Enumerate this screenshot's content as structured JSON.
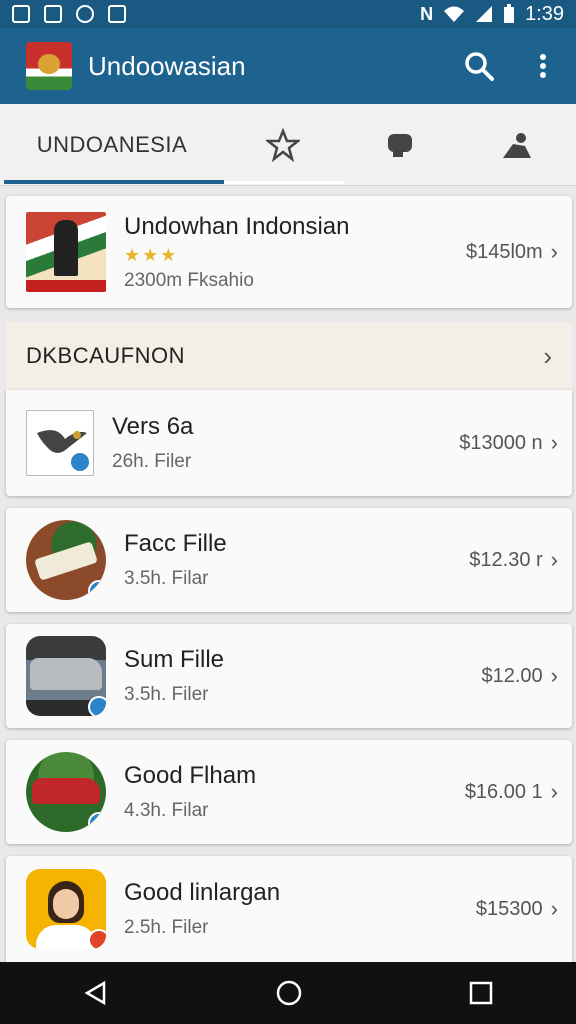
{
  "status_bar": {
    "network_label": "N",
    "time": "1:39",
    "icons": [
      "notification-icon",
      "notification-icon",
      "notification-icon",
      "notification-icon",
      "wifi-icon",
      "signal-icon",
      "battery-icon"
    ]
  },
  "app_bar": {
    "title": "Undoowasian",
    "logo": "flag-logo",
    "actions": [
      "search-icon",
      "more-vert-icon"
    ]
  },
  "tabs": [
    {
      "label": "UNDOANESIA",
      "selected": true
    },
    {
      "icon": "star-icon"
    },
    {
      "icon": "chat-icon"
    },
    {
      "icon": "person-icon"
    }
  ],
  "featured": {
    "title": "Undowhan Indonsian",
    "rating_stars": 3,
    "subtitle": "2300m Fksahio",
    "price": "$145l0m"
  },
  "section": {
    "title": "DKBCAUFNON"
  },
  "items": [
    {
      "name": "Vers 6a",
      "sub": "26h. Filer",
      "price": "$13000 n"
    },
    {
      "name": "Facc Fille",
      "sub": "3.5h. Filar",
      "price": "$12.30 r"
    },
    {
      "name": "Sum Fille",
      "sub": "3.5h. Filer",
      "price": "$12.00"
    },
    {
      "name": "Good Flham",
      "sub": "4.3h. Filar",
      "price": "$16.00 1"
    },
    {
      "name": "Good linlargan",
      "sub": "2.5h. Filer",
      "price": "$15300"
    }
  ],
  "nav": [
    "back-icon",
    "home-icon",
    "recents-icon"
  ],
  "colors": {
    "primary": "#1e6390",
    "status": "#1a5a82",
    "accent_star": "#e8b52b"
  }
}
